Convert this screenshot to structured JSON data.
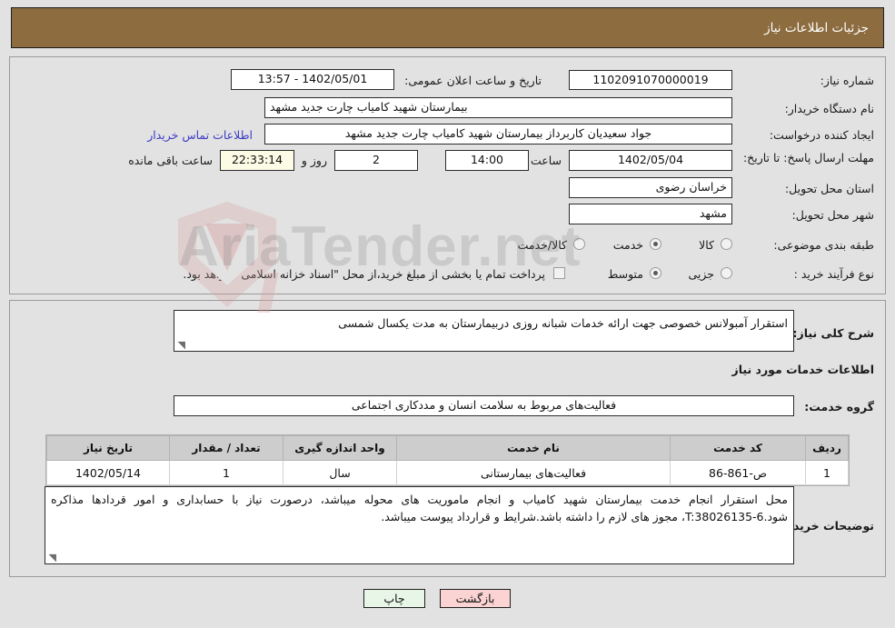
{
  "header": {
    "title": "جزئیات اطلاعات نیاز"
  },
  "watermark": {
    "brand": "AriaTender.net",
    "top": "AriaTender.net"
  },
  "top_section": {
    "need_number_label": "شماره نیاز:",
    "need_number_value": "1102091070000019",
    "announce_label": "تاریخ و ساعت اعلان عمومی:",
    "announce_value": "1402/05/01 - 13:57",
    "buyer_org_label": "نام دستگاه خریدار:",
    "buyer_org_value": "بیمارستان شهید کامیاب چارت جدید مشهد",
    "requester_label": "ایجاد کننده درخواست:",
    "requester_value": "جواد سعیدیان کاربرداز بیمارستان شهید کامیاب چارت جدید مشهد",
    "contact_link": "اطلاعات تماس خریدار",
    "deadline_label": "مهلت ارسال پاسخ: تا تاریخ:",
    "deadline_date": "1402/05/04",
    "hour_label": "ساعت",
    "deadline_time": "14:00",
    "days_value": "2",
    "days_label": "روز و",
    "countdown_value": "22:33:14",
    "remaining_label": "ساعت باقی مانده",
    "province_label": "استان محل تحویل:",
    "province_value": "خراسان رضوی",
    "city_label": "شهر محل تحویل:",
    "city_value": "مشهد",
    "category_label": "طبقه بندی موضوعی:",
    "category_options": [
      "کالا",
      "خدمت",
      "کالا/خدمت"
    ],
    "category_selected": "خدمت",
    "process_label": "نوع فرآیند خرید :",
    "process_options": [
      "جزیی",
      "متوسط"
    ],
    "process_selected": "متوسط",
    "treasury_note": "پرداخت تمام یا بخشی از مبلغ خرید،از محل \"اسناد خزانه اسلامی\" خواهد بود.",
    "treasury_checked": false
  },
  "body_section": {
    "summary_label": "شرح کلی نیاز:",
    "summary_value": "استقرار آمبولانس خصوصی جهت ارائه خدمات شبانه روزی دربیمارستان به مدت یکسال شمسی",
    "services_heading": "اطلاعات خدمات مورد نیاز",
    "service_group_label": "گروه خدمت:",
    "service_group_value": "فعالیت‌های مربوط به سلامت انسان و مددکاری اجتماعی",
    "table": {
      "columns": [
        "ردیف",
        "کد خدمت",
        "نام خدمت",
        "واحد اندازه گیری",
        "تعداد / مقدار",
        "تاریخ نیاز"
      ],
      "rows": [
        [
          "1",
          "ص-861-86",
          "فعالیت‌های بیمارستانی",
          "سال",
          "1",
          "1402/05/14"
        ]
      ]
    },
    "notes_label": "توضیحات خریدار:",
    "notes_value": "محل استقرار انجام خدمت بیمارستان شهید کامیاب و انجام ماموریت های محوله میباشد، درصورت نیاز با حسابداری و امور قردادها مذاکره شود.T:38026135-6، مجوز های لازم را داشته باشد.شرایط و قرارداد پیوست میباشد."
  },
  "footer": {
    "print_label": "چاپ",
    "back_label": "بازگشت"
  },
  "colors": {
    "header_bg": "#8d6c3f",
    "page_bg": "#e2e2e2",
    "link": "#3b3bc4",
    "print_btn": "#e8f6e8",
    "back_btn": "#fbd3d3",
    "countdown_bg": "#fbfbe6",
    "table_header_bg": "#cdcdcd"
  }
}
